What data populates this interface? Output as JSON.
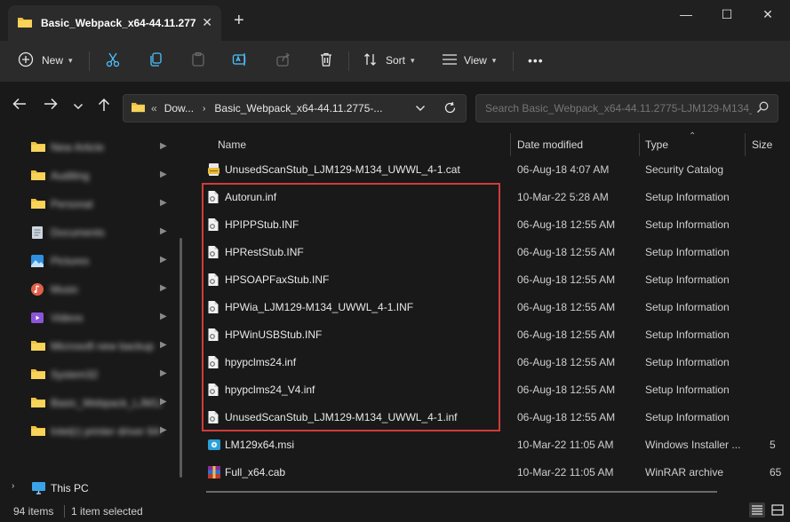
{
  "window": {
    "tab_title": "Basic_Webpack_x64-44.11.277",
    "tab_close": "✕",
    "new_tab": "+",
    "minimize": "—",
    "maximize": "☐",
    "close": "✕"
  },
  "toolbar": {
    "new_label": "New",
    "sort_label": "Sort",
    "view_label": "View",
    "more": "•••"
  },
  "address": {
    "overflow": "«",
    "segment1": "Dow...",
    "segment2": "Basic_Webpack_x64-44.11.2775-...",
    "search_placeholder": "Search Basic_Webpack_x64-44.11.2775-LJM129-M134_..."
  },
  "sidebar": {
    "items": [
      {
        "label": "New Article",
        "icon": "folder-icon"
      },
      {
        "label": "Auditing",
        "icon": "folder-icon"
      },
      {
        "label": "Personal",
        "icon": "folder-icon"
      },
      {
        "label": "Documents",
        "icon": "documents-icon"
      },
      {
        "label": "Pictures",
        "icon": "pictures-icon"
      },
      {
        "label": "Music",
        "icon": "music-icon"
      },
      {
        "label": "Videos",
        "icon": "videos-icon"
      },
      {
        "label": "Microsoft new backup",
        "icon": "folder-icon"
      },
      {
        "label": "System32",
        "icon": "folder-icon"
      },
      {
        "label": "Basic_Webpack_LJM129-M134",
        "icon": "folder-icon"
      },
      {
        "label": "Intel(r) printer driver 64-bit",
        "icon": "folder-icon"
      }
    ],
    "this_pc": "This PC"
  },
  "columns": {
    "name": "Name",
    "date": "Date modified",
    "type": "Type",
    "size": "Size"
  },
  "files": [
    {
      "name": "UnusedScanStub_LJM129-M134_UWWL_4-1.cat",
      "date": "06-Aug-18 4:07 AM",
      "type": "Security Catalog",
      "size": "",
      "icon": "catalog-icon"
    },
    {
      "name": "Autorun.inf",
      "date": "10-Mar-22 5:28 AM",
      "type": "Setup Information",
      "size": "",
      "icon": "inf-file-icon"
    },
    {
      "name": "HPIPPStub.INF",
      "date": "06-Aug-18 12:55 AM",
      "type": "Setup Information",
      "size": "",
      "icon": "inf-file-icon"
    },
    {
      "name": "HPRestStub.INF",
      "date": "06-Aug-18 12:55 AM",
      "type": "Setup Information",
      "size": "",
      "icon": "inf-file-icon"
    },
    {
      "name": "HPSOAPFaxStub.INF",
      "date": "06-Aug-18 12:55 AM",
      "type": "Setup Information",
      "size": "",
      "icon": "inf-file-icon"
    },
    {
      "name": "HPWia_LJM129-M134_UWWL_4-1.INF",
      "date": "06-Aug-18 12:55 AM",
      "type": "Setup Information",
      "size": "",
      "icon": "inf-file-icon"
    },
    {
      "name": "HPWinUSBStub.INF",
      "date": "06-Aug-18 12:55 AM",
      "type": "Setup Information",
      "size": "",
      "icon": "inf-file-icon"
    },
    {
      "name": "hpypclms24.inf",
      "date": "06-Aug-18 12:55 AM",
      "type": "Setup Information",
      "size": "",
      "icon": "inf-file-icon"
    },
    {
      "name": "hpypclms24_V4.inf",
      "date": "06-Aug-18 12:55 AM",
      "type": "Setup Information",
      "size": "",
      "icon": "inf-file-icon"
    },
    {
      "name": "UnusedScanStub_LJM129-M134_UWWL_4-1.inf",
      "date": "06-Aug-18 12:55 AM",
      "type": "Setup Information",
      "size": "",
      "icon": "inf-file-icon"
    },
    {
      "name": "LM129x64.msi",
      "date": "10-Mar-22 11:05 AM",
      "type": "Windows Installer ...",
      "size": "5",
      "icon": "msi-icon"
    },
    {
      "name": "Full_x64.cab",
      "date": "10-Mar-22 11:05 AM",
      "type": "WinRAR archive",
      "size": "65",
      "icon": "winrar-icon"
    }
  ],
  "status": {
    "items": "94 items",
    "selected": "1 item selected"
  },
  "colors": {
    "accent_blue": "#4cc2ff",
    "folder_yellow": "#f0c040",
    "highlight_red": "#d23b3b"
  }
}
